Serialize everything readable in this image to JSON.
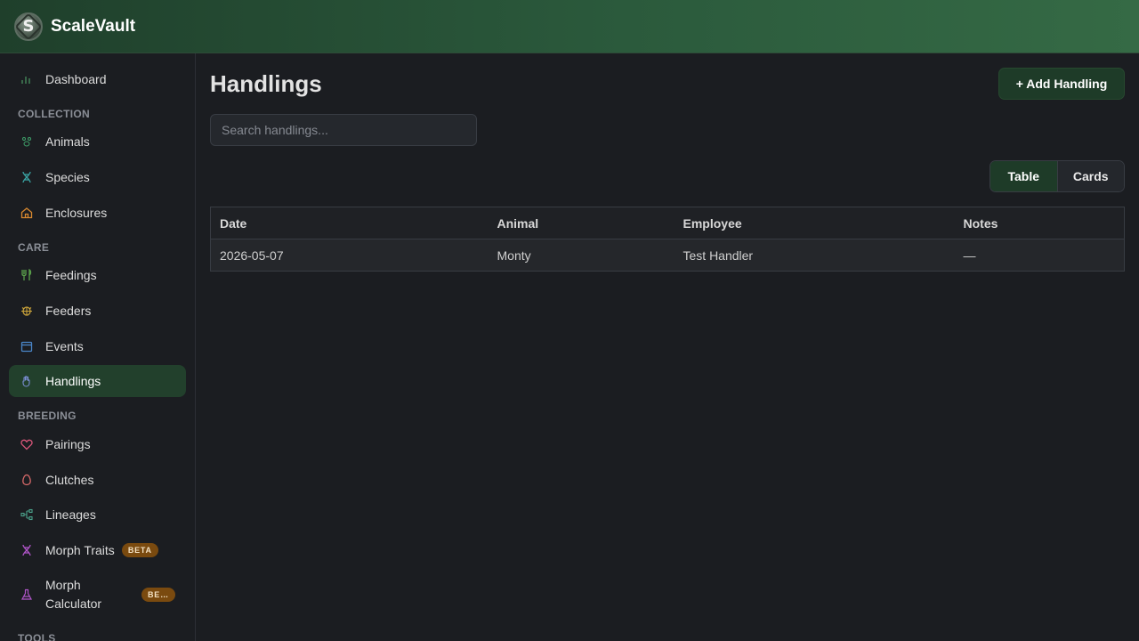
{
  "app": {
    "name": "ScaleVault",
    "logo_letter": "S"
  },
  "sidebar": {
    "top_item": {
      "label": "Dashboard",
      "icon": "bar-chart-icon"
    },
    "sections": [
      {
        "label": "COLLECTION"
      },
      {
        "label": "CARE"
      },
      {
        "label": "BREEDING"
      },
      {
        "label": "TOOLS"
      }
    ],
    "items": [
      {
        "label": "Animals",
        "icon": "paw-icon"
      },
      {
        "label": "Species",
        "icon": "dna-icon"
      },
      {
        "label": "Enclosures",
        "icon": "home-icon"
      },
      {
        "label": "Feedings",
        "icon": "fork-knife-icon"
      },
      {
        "label": "Feeders",
        "icon": "bug-icon"
      },
      {
        "label": "Events",
        "icon": "calendar-icon"
      },
      {
        "label": "Handlings",
        "icon": "hand-icon",
        "active": true
      },
      {
        "label": "Pairings",
        "icon": "heart-icon"
      },
      {
        "label": "Clutches",
        "icon": "egg-icon"
      },
      {
        "label": "Lineages",
        "icon": "tree-icon"
      },
      {
        "label": "Morph Traits",
        "icon": "dna-icon",
        "badge": "BETA"
      },
      {
        "label": "Morph Calculator",
        "label_line1": "Morph",
        "label_line2": "Calculator",
        "icon": "flask-icon",
        "badge": "BETA"
      }
    ],
    "colors": {
      "active_bg": "#22402c",
      "badge_bg": "#7a4a0f"
    }
  },
  "header": {
    "title": "Handlings",
    "add_button_label": "+ Add Handling"
  },
  "search": {
    "placeholder": "Search handlings...",
    "value": ""
  },
  "view_toggle": {
    "options": [
      "Table",
      "Cards"
    ],
    "selected": "Table"
  },
  "table": {
    "columns": [
      "Date",
      "Animal",
      "Employee",
      "Notes"
    ],
    "rows": [
      {
        "date": "2026-05-07",
        "animal": "Monty",
        "employee": "Test Handler",
        "notes": "—"
      }
    ]
  }
}
